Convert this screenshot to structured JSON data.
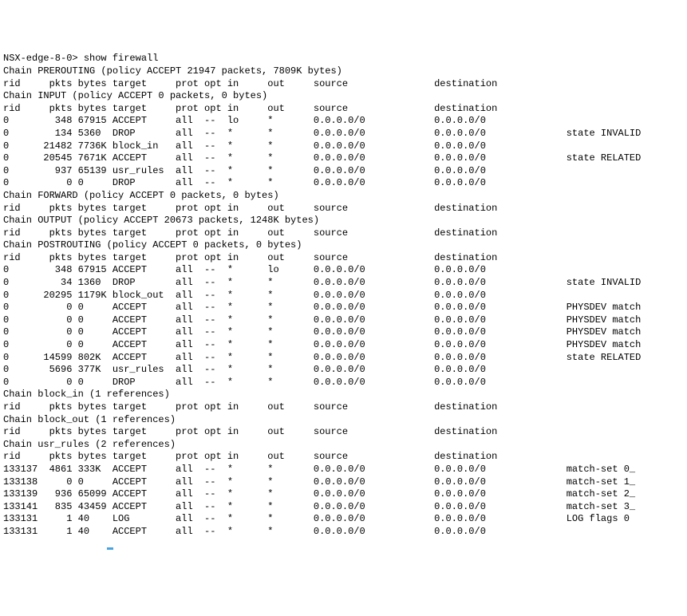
{
  "prompt": "NSX-edge-8-0> ",
  "command": "show firewall",
  "hdr": {
    "rid": "rid",
    "pkts": "pkts",
    "bytes": "bytes",
    "target": "target",
    "prot": "prot",
    "opt": "opt",
    "in": "in",
    "out": "out",
    "source": "source",
    "destination": "destination"
  },
  "anyip": "0.0.0.0/0",
  "all": "all",
  "dd": "--",
  "star": "*",
  "lo": "lo",
  "chains": {
    "prerouting": "Chain PREROUTING (policy ACCEPT 21947 packets, 7809K bytes)",
    "input": "Chain INPUT (policy ACCEPT 0 packets, 0 bytes)",
    "forward": "Chain FORWARD (policy ACCEPT 0 packets, 0 bytes)",
    "output": "Chain OUTPUT (policy ACCEPT 20673 packets, 1248K bytes)",
    "postrouting": "Chain POSTROUTING (policy ACCEPT 0 packets, 0 bytes)",
    "block_in": "Chain block_in (1 references)",
    "block_out": "Chain block_out (1 references)",
    "usr_rules": "Chain usr_rules (2 references)"
  },
  "input_rows": [
    {
      "rid": "0",
      "pkts": "348",
      "bytes": "67915",
      "target": "ACCEPT",
      "in": "lo",
      "out": "*",
      "extra": ""
    },
    {
      "rid": "0",
      "pkts": "134",
      "bytes": "5360",
      "target": "DROP",
      "in": "*",
      "out": "*",
      "extra": "state INVALID"
    },
    {
      "rid": "0",
      "pkts": "21482",
      "bytes": "7736K",
      "target": "block_in",
      "in": "*",
      "out": "*",
      "extra": ""
    },
    {
      "rid": "0",
      "pkts": "20545",
      "bytes": "7671K",
      "target": "ACCEPT",
      "in": "*",
      "out": "*",
      "extra": "state RELATED"
    },
    {
      "rid": "0",
      "pkts": "937",
      "bytes": "65139",
      "target": "usr_rules",
      "in": "*",
      "out": "*",
      "extra": ""
    },
    {
      "rid": "0",
      "pkts": "0",
      "bytes": "0",
      "target": "DROP",
      "in": "*",
      "out": "*",
      "extra": ""
    }
  ],
  "post_rows": [
    {
      "rid": "0",
      "pkts": "348",
      "bytes": "67915",
      "target": "ACCEPT",
      "in": "*",
      "out": "lo",
      "extra": ""
    },
    {
      "rid": "0",
      "pkts": "34",
      "bytes": "1360",
      "target": "DROP",
      "in": "*",
      "out": "*",
      "extra": "state INVALID"
    },
    {
      "rid": "0",
      "pkts": "20295",
      "bytes": "1179K",
      "target": "block_out",
      "in": "*",
      "out": "*",
      "extra": ""
    },
    {
      "rid": "0",
      "pkts": "0",
      "bytes": "0",
      "target": "ACCEPT",
      "in": "*",
      "out": "*",
      "extra": "PHYSDEV match"
    },
    {
      "rid": "0",
      "pkts": "0",
      "bytes": "0",
      "target": "ACCEPT",
      "in": "*",
      "out": "*",
      "extra": "PHYSDEV match"
    },
    {
      "rid": "0",
      "pkts": "0",
      "bytes": "0",
      "target": "ACCEPT",
      "in": "*",
      "out": "*",
      "extra": "PHYSDEV match"
    },
    {
      "rid": "0",
      "pkts": "0",
      "bytes": "0",
      "target": "ACCEPT",
      "in": "*",
      "out": "*",
      "extra": "PHYSDEV match"
    },
    {
      "rid": "0",
      "pkts": "14599",
      "bytes": "802K",
      "target": "ACCEPT",
      "in": "*",
      "out": "*",
      "extra": "state RELATED"
    },
    {
      "rid": "0",
      "pkts": "5696",
      "bytes": "377K",
      "target": "usr_rules",
      "in": "*",
      "out": "*",
      "extra": ""
    },
    {
      "rid": "0",
      "pkts": "0",
      "bytes": "0",
      "target": "DROP",
      "in": "*",
      "out": "*",
      "extra": ""
    }
  ],
  "usr_rows": [
    {
      "rid": "133137",
      "pkts": "4861",
      "bytes": "333K",
      "target": "ACCEPT",
      "in": "*",
      "out": "*",
      "extra": "match-set 0_"
    },
    {
      "rid": "133138",
      "pkts": "0",
      "bytes": "0",
      "target": "ACCEPT",
      "in": "*",
      "out": "*",
      "extra": "match-set 1_"
    },
    {
      "rid": "133139",
      "pkts": "936",
      "bytes": "65099",
      "target": "ACCEPT",
      "in": "*",
      "out": "*",
      "extra": "match-set 2_"
    },
    {
      "rid": "133141",
      "pkts": "835",
      "bytes": "43459",
      "target": "ACCEPT",
      "in": "*",
      "out": "*",
      "extra": "match-set 3_"
    },
    {
      "rid": "133131",
      "pkts": "1",
      "bytes": "40",
      "target": "LOG",
      "in": "*",
      "out": "*",
      "extra": "LOG flags 0"
    },
    {
      "rid": "133131",
      "pkts": "1",
      "bytes": "40",
      "target": "ACCEPT",
      "in": "*",
      "out": "*",
      "extra": ""
    }
  ]
}
